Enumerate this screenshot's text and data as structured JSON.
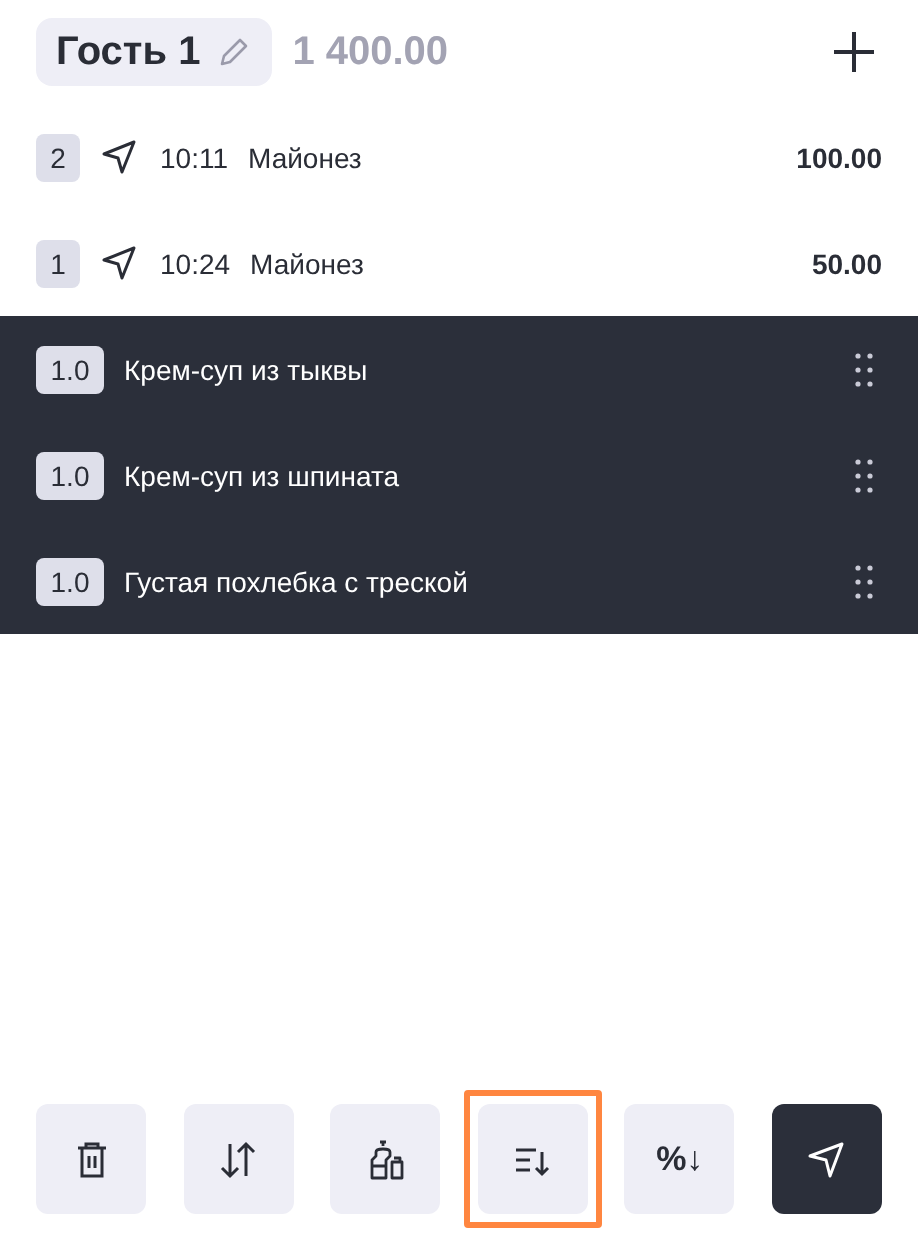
{
  "guest": {
    "name": "Гость 1",
    "total": "1 400.00"
  },
  "items": [
    {
      "kind": "sent",
      "qty": "2",
      "time": "10:11",
      "name": "Майонез",
      "price": "100.00"
    },
    {
      "kind": "sent",
      "qty": "1",
      "time": "10:24",
      "name": "Майонез",
      "price": "50.00"
    },
    {
      "kind": "pending",
      "qty": "1.0",
      "name": "Крем-суп из тыквы"
    },
    {
      "kind": "pending",
      "qty": "1.0",
      "name": "Крем-суп из шпината"
    },
    {
      "kind": "pending",
      "qty": "1.0",
      "name": "Густая похлебка с треской"
    }
  ],
  "toolbar": [
    {
      "kind": "delete",
      "highlighted": false
    },
    {
      "kind": "swap",
      "highlighted": false
    },
    {
      "kind": "condiments",
      "highlighted": false
    },
    {
      "kind": "sort",
      "highlighted": true
    },
    {
      "kind": "text",
      "label": "%↓",
      "highlighted": false
    },
    {
      "kind": "send",
      "highlighted": false
    }
  ]
}
